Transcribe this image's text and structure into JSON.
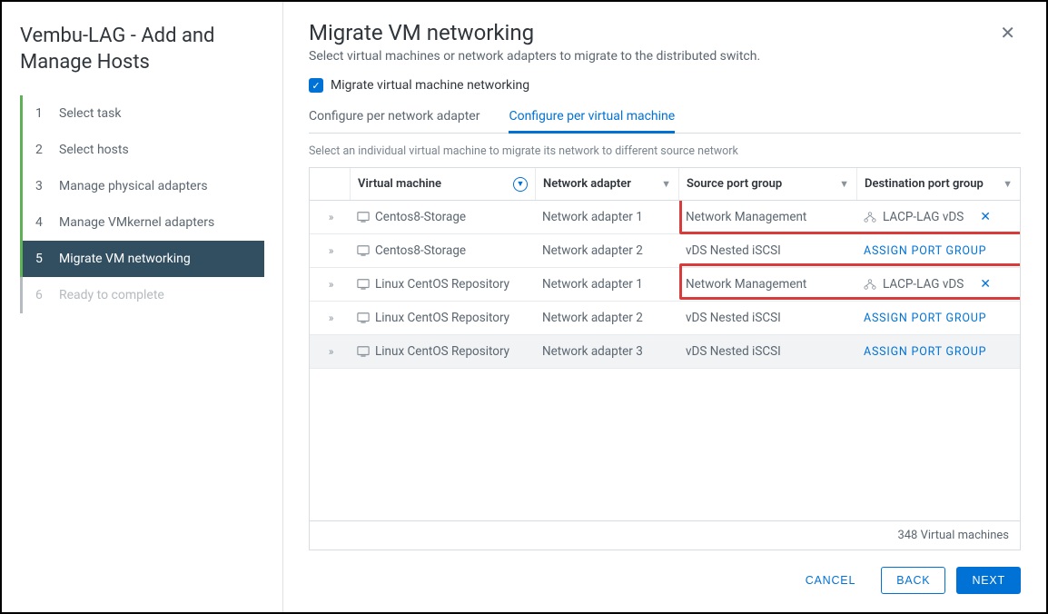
{
  "sidebar": {
    "title": "Vembu-LAG - Add and Manage Hosts",
    "steps": [
      {
        "num": "1",
        "label": "Select task"
      },
      {
        "num": "2",
        "label": "Select hosts"
      },
      {
        "num": "3",
        "label": "Manage physical adapters"
      },
      {
        "num": "4",
        "label": "Manage VMkernel adapters"
      },
      {
        "num": "5",
        "label": "Migrate VM networking"
      },
      {
        "num": "6",
        "label": "Ready to complete"
      }
    ]
  },
  "main": {
    "title": "Migrate VM networking",
    "subtitle": "Select virtual machines or network adapters to migrate to the distributed switch.",
    "checkbox_label": "Migrate virtual machine networking",
    "tabs": {
      "per_adapter": "Configure per network adapter",
      "per_vm": "Configure per virtual machine"
    },
    "help": "Select an individual virtual machine to migrate its network to different source network",
    "columns": {
      "vm": "Virtual machine",
      "na": "Network adapter",
      "sp": "Source port group",
      "dp": "Destination port group"
    },
    "rows": [
      {
        "vm": "Centos8-Storage",
        "na": "Network adapter 1",
        "sp": "Network Management",
        "dp": "LACP-LAG vDS",
        "assigned": true
      },
      {
        "vm": "Centos8-Storage",
        "na": "Network adapter 2",
        "sp": "vDS Nested iSCSI",
        "dp": "ASSIGN PORT GROUP",
        "assigned": false
      },
      {
        "vm": "Linux CentOS Repository",
        "na": "Network adapter 1",
        "sp": "Network Management",
        "dp": "LACP-LAG vDS",
        "assigned": true
      },
      {
        "vm": "Linux CentOS Repository",
        "na": "Network adapter 2",
        "sp": "vDS Nested iSCSI",
        "dp": "ASSIGN PORT GROUP",
        "assigned": false
      },
      {
        "vm": "Linux CentOS Repository",
        "na": "Network adapter 3",
        "sp": "vDS Nested iSCSI",
        "dp": "ASSIGN PORT GROUP",
        "assigned": false
      }
    ],
    "footer_count": "348 Virtual machines",
    "buttons": {
      "cancel": "CANCEL",
      "back": "BACK",
      "next": "NEXT"
    }
  }
}
